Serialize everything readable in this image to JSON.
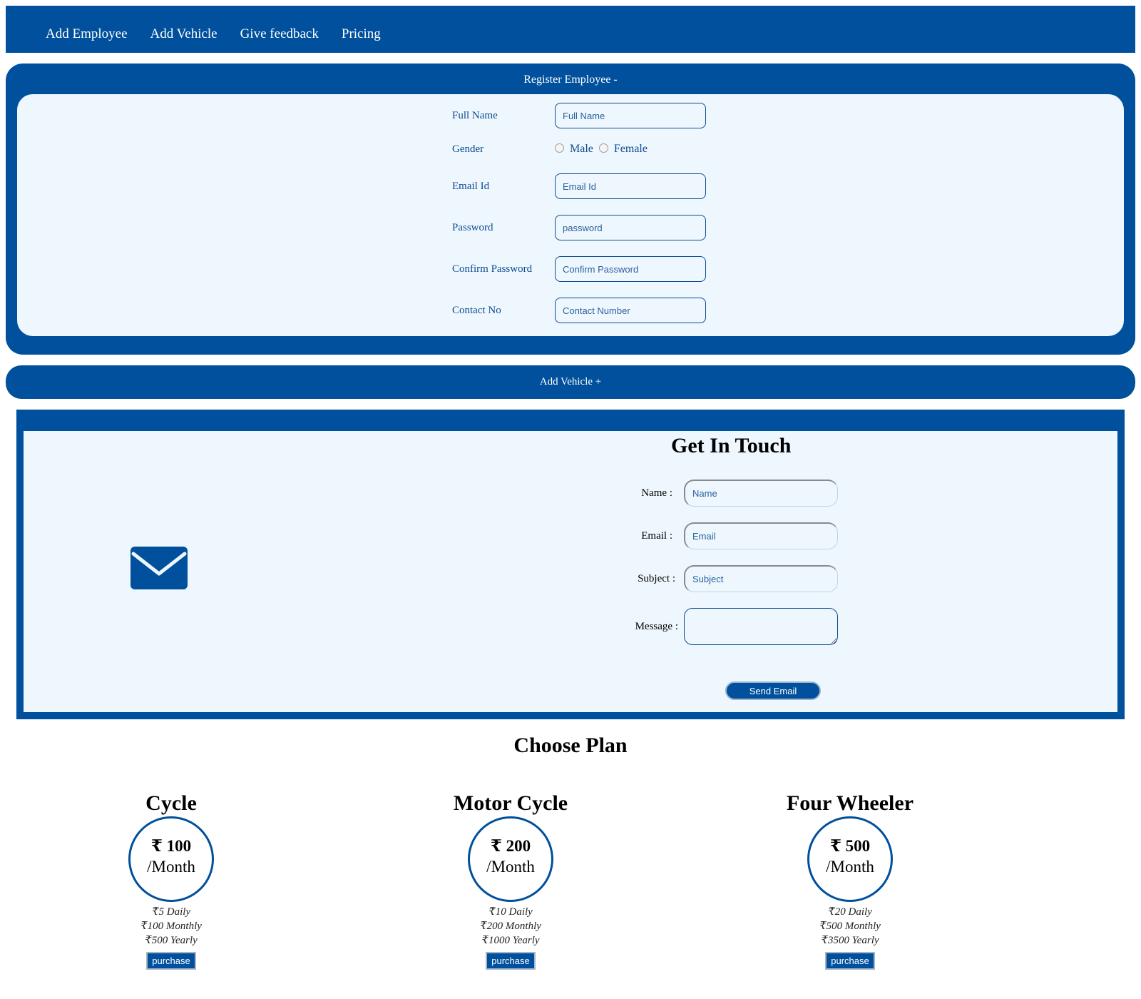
{
  "nav": {
    "items": [
      "Add Employee",
      "Add Vehicle",
      "Give feedback",
      "Pricing"
    ]
  },
  "register": {
    "title": "Register Employee -",
    "fields": {
      "full_name": {
        "label": "Full Name",
        "placeholder": "Full Name"
      },
      "gender": {
        "label": "Gender",
        "options": [
          "Male",
          "Female"
        ]
      },
      "email": {
        "label": "Email Id",
        "placeholder": "Email Id"
      },
      "password": {
        "label": "Password",
        "placeholder": "password"
      },
      "confirm_password": {
        "label": "Confirm Password",
        "placeholder": "Confirm Password"
      },
      "contact": {
        "label": "Contact No",
        "placeholder": "Contact Number"
      }
    }
  },
  "add_vehicle": {
    "label": "Add Vehicle +"
  },
  "contact": {
    "title": "Get In Touch",
    "name": {
      "label": "Name :",
      "placeholder": "Name"
    },
    "email": {
      "label": "Email :",
      "placeholder": "Email"
    },
    "subject": {
      "label": "Subject :",
      "placeholder": "Subject"
    },
    "message": {
      "label": "Message :"
    },
    "send_label": "Send Email"
  },
  "pricing": {
    "title": "Choose Plan",
    "plans": [
      {
        "name": "Cycle",
        "price": "₹ 100",
        "per": "/Month",
        "daily": "₹5 Daily",
        "monthly": "₹100 Monthly",
        "yearly": "₹500 Yearly",
        "button": "purchase"
      },
      {
        "name": "Motor Cycle",
        "price": "₹ 200",
        "per": "/Month",
        "daily": "₹10 Daily",
        "monthly": "₹200 Monthly",
        "yearly": "₹1000 Yearly",
        "button": "purchase"
      },
      {
        "name": "Four Wheeler",
        "price": "₹ 500",
        "per": "/Month",
        "daily": "₹20 Daily",
        "monthly": "₹500 Monthly",
        "yearly": "₹3500 Yearly",
        "button": "purchase"
      }
    ]
  },
  "colors": {
    "primary": "#00509d",
    "panel_bg": "#eef7fd",
    "label_text": "#0c4a91"
  },
  "icons": {
    "contact": "envelope-icon"
  }
}
